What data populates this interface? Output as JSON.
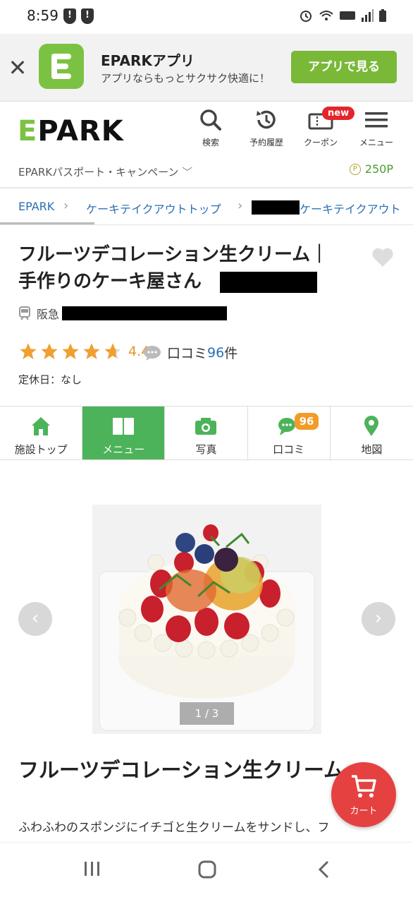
{
  "status_bar": {
    "time": "8:59"
  },
  "app_banner": {
    "title": "EPARKアプリ",
    "subtitle": "アプリならもっとサクサク快適に！",
    "button_label": "アプリで見る"
  },
  "header": {
    "logo": "EPARK",
    "nav": [
      {
        "label": "検索",
        "icon": "search-icon"
      },
      {
        "label": "予約履歴",
        "icon": "history-icon"
      },
      {
        "label": "クーポン",
        "icon": "coupon-icon",
        "badge": "new"
      },
      {
        "label": "メニュー",
        "icon": "hamburger-icon"
      }
    ],
    "passport_link": "EPARKパスポート・キャンペーン",
    "points": "250P"
  },
  "breadcrumb": {
    "items": [
      "EPARK",
      "ケーキテイクアウトトップ",
      "ケーキテイクアウト"
    ]
  },
  "shop": {
    "name_line1": "フルーツデコレーション生クリーム｜",
    "name_line2": "手作りのケーキ屋さん",
    "station_prefix": "阪急",
    "rating": "4.4",
    "review_prefix": "口コミ",
    "review_count": "96",
    "review_suffix": "件",
    "closed_days": "定休日：なし"
  },
  "tabs": [
    {
      "label": "施設トップ",
      "icon": "home-icon"
    },
    {
      "label": "メニュー",
      "icon": "book-icon",
      "active": true
    },
    {
      "label": "写真",
      "icon": "camera-icon"
    },
    {
      "label": "口コミ",
      "icon": "chat-icon",
      "badge": "96"
    },
    {
      "label": "地図",
      "icon": "map-pin-icon"
    }
  ],
  "product": {
    "image_counter": "1 / 3",
    "title": "フルーツデコレーション生クリーム",
    "description": "ふわふわのスポンジにイチゴと生クリームをサンドし、フ"
  },
  "cart": {
    "label": "カート"
  },
  "colors": {
    "brand_green": "#7cc242",
    "tab_active": "#4cb35a",
    "link_blue": "#2a6fb5",
    "star_orange": "#f0a030",
    "cart_red": "#e54141"
  }
}
